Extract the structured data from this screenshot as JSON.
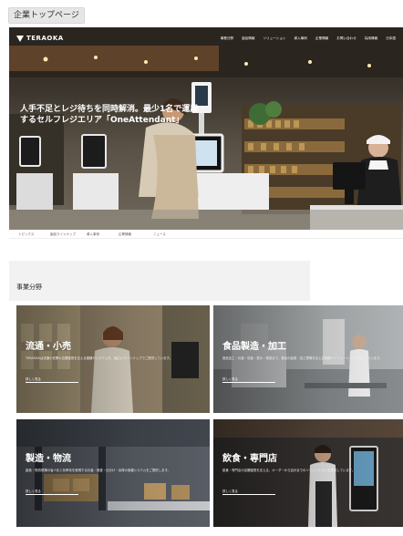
{
  "page_label": "企業トップページ",
  "header": {
    "logo": "TERAOKA",
    "nav": [
      "事業分野",
      "製品情報",
      "ソリューション",
      "導入事例",
      "企業情報",
      "お問い合わせ",
      "採用情報",
      "日本語"
    ]
  },
  "hero": {
    "eyebrow": "",
    "title": "人手不足とレジ待ちを同時解消。最少1名で運用するセルフレジエリア「OneAttendant」"
  },
  "tabs": [
    "トピックス",
    "製品ラインナップ",
    "導入事例",
    "企業情報",
    "ニュース"
  ],
  "business": {
    "title": "事業分野",
    "cards": [
      {
        "title": "流通・小売",
        "desc": "TERAOKAは流通小売業の店舗運営を支える機器やシステムを、幅広いラインナップでご提供しています。",
        "more": "詳しく見る"
      },
      {
        "title": "食品製造・加工",
        "desc": "食品加工・計量・包装・表示・検査まで、食品の製造・加工現場を支える機器やソリューションを提供しています。",
        "more": "詳しく見る"
      },
      {
        "title": "製造・物流",
        "desc": "製造・物流現場の省人化と効率化を実現する計量・検査・仕分け・出荷の各種システムをご提供します。",
        "more": "詳しく見る"
      },
      {
        "title": "飲食・専門店",
        "desc": "飲食・専門店の店舗運営を支える、オーダーから会計までのソリューションを提供しています。",
        "more": "詳しく見る"
      }
    ]
  },
  "colors": {
    "brand": "#c8102e",
    "card_overlay": "#000000"
  }
}
